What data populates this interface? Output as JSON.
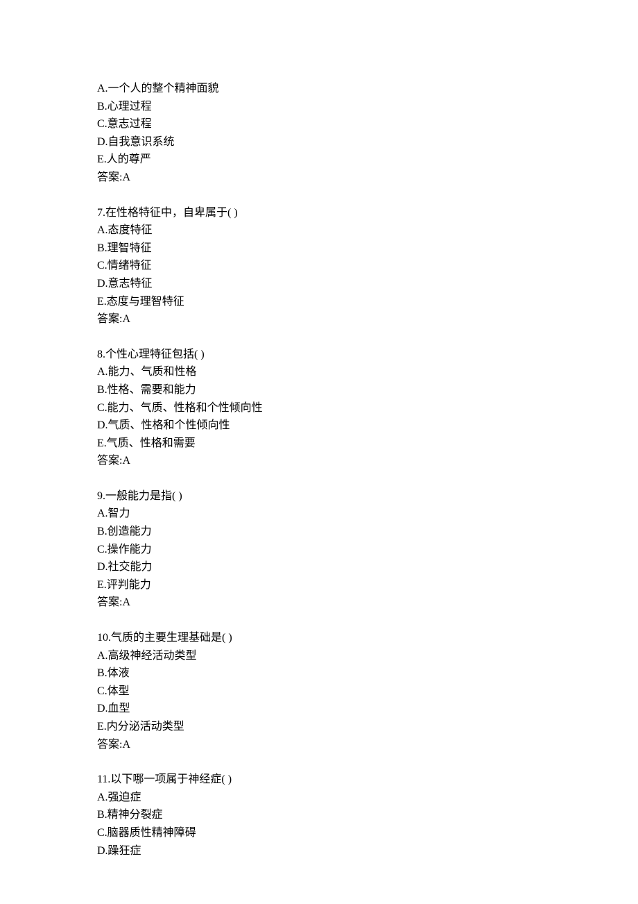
{
  "questions": [
    {
      "number": "",
      "stem": "",
      "options": [
        "A.一个人的整个精神面貌",
        "B.心理过程",
        "C.意志过程",
        "D.自我意识系统",
        "E.人的尊严"
      ],
      "answer": "答案:A"
    },
    {
      "number": "7.",
      "stem": "在性格特征中，自卑属于( )",
      "options": [
        "A.态度特征",
        "B.理智特征",
        "C.情绪特征",
        "D.意志特征",
        "E.态度与理智特征"
      ],
      "answer": "答案:A"
    },
    {
      "number": "8.",
      "stem": "个性心理特征包括( )",
      "options": [
        "A.能力、气质和性格",
        "B.性格、需要和能力",
        "C.能力、气质、性格和个性倾向性",
        "D.气质、性格和个性倾向性",
        "E.气质、性格和需要"
      ],
      "answer": "答案:A"
    },
    {
      "number": "9.",
      "stem": "一般能力是指( )",
      "options": [
        "A.智力",
        "B.创造能力",
        "C.操作能力",
        "D.社交能力",
        "E.评判能力"
      ],
      "answer": "答案:A"
    },
    {
      "number": "10.",
      "stem": "气质的主要生理基础是( )",
      "options": [
        "A.高级神经活动类型",
        "B.体液",
        "C.体型",
        "D.血型",
        "E.内分泌活动类型"
      ],
      "answer": "答案:A"
    },
    {
      "number": "11.",
      "stem": "以下哪一项属于神经症( )",
      "options": [
        "A.强迫症",
        "B.精神分裂症",
        "C.脑器质性精神障碍",
        "D.躁狂症"
      ],
      "answer": ""
    }
  ]
}
